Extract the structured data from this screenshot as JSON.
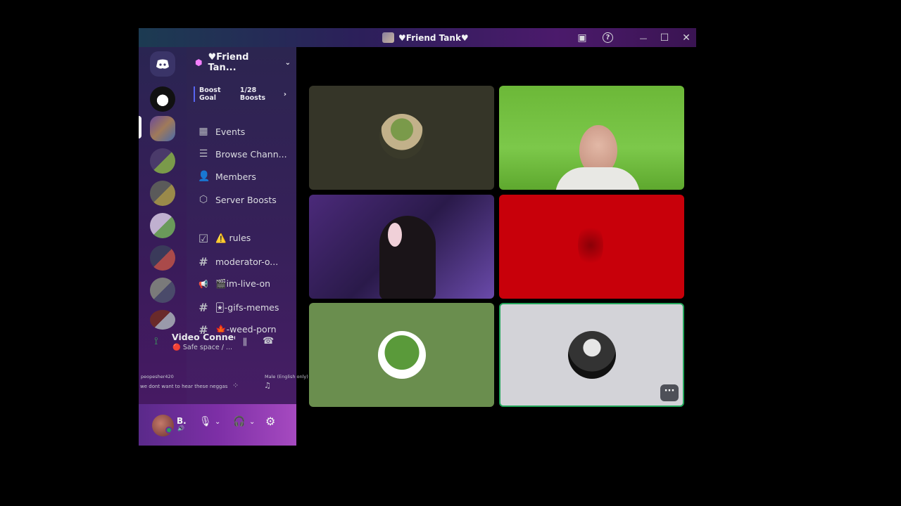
{
  "window": {
    "title": "♥Friend Tank♥",
    "buttons": {
      "inbox": "▣",
      "help": "?",
      "minimize": "—",
      "maximize": "☐",
      "close": "✕"
    }
  },
  "server": {
    "name": "♥Friend Tan...",
    "boost_goal_label": "Boost Goal",
    "boost_count": "1/28 Boosts"
  },
  "nav": [
    {
      "icon": "calendar-icon",
      "glyph": "▦",
      "label": "Events"
    },
    {
      "icon": "browse-channels-icon",
      "glyph": "☰",
      "label": "Browse Chann..."
    },
    {
      "icon": "members-icon",
      "glyph": "👤",
      "label": "Members"
    },
    {
      "icon": "boost-icon",
      "glyph": "⬡",
      "label": "Server Boosts"
    }
  ],
  "channels": [
    {
      "icon": "rules-icon",
      "glyph": "☑",
      "label": "⚠️ rules"
    },
    {
      "icon": "hash-icon",
      "glyph": "#",
      "label": "moderator-o..."
    },
    {
      "icon": "announcement-icon",
      "glyph": "📢",
      "label": "🎬im-live-on"
    },
    {
      "icon": "hash-icon",
      "glyph": "#",
      "label": "🃏-gifs-memes"
    },
    {
      "icon": "hash-icon",
      "glyph": "#",
      "label": "🍁-weed-porn"
    }
  ],
  "voice": {
    "status": "Video Connec",
    "channel": "🔴 Safe space / ..."
  },
  "overlay": {
    "user": "peopesher420",
    "message": "we dont want to hear these neggas",
    "right_label": "Male (English only)"
  },
  "user": {
    "name": "B."
  },
  "colors": {
    "tile_dark": "#353528",
    "tile_green": "#7ac24a",
    "tile_red": "#c8000a",
    "tile_olive": "#6a8e4e",
    "tile_light": "#d3d3d8",
    "online": "#23a55a",
    "accent": "#5865f2"
  },
  "tiles": [
    {
      "name": "frog-avatar-tile"
    },
    {
      "name": "greenscreen-video-tile"
    },
    {
      "name": "cat-ears-video-tile"
    },
    {
      "name": "red-video-tile"
    },
    {
      "name": "pepe-avatar-tile"
    },
    {
      "name": "bw-avatar-tile"
    }
  ],
  "more_button": "···"
}
